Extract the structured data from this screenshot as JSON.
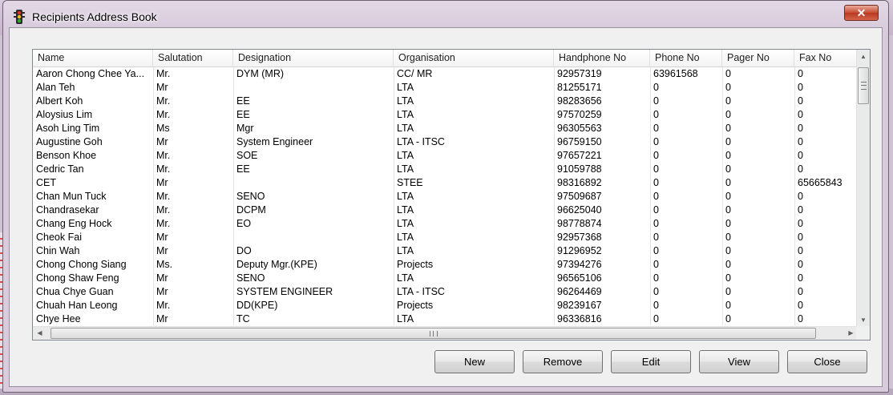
{
  "window": {
    "title": "Recipients Address Book",
    "close_symbol": "✕"
  },
  "columns": [
    "Name",
    "Salutation",
    "Designation",
    "Organisation",
    "Handphone No",
    "Phone No",
    "Pager No",
    "Fax No"
  ],
  "rows": [
    [
      "Aaron Chong Chee Ya...",
      "Mr.",
      "DYM (MR)",
      "CC/ MR",
      "92957319",
      "63961568",
      "0",
      "0"
    ],
    [
      "Alan Teh",
      "Mr",
      "",
      "LTA",
      "81255171",
      "0",
      "0",
      "0"
    ],
    [
      "Albert Koh",
      "Mr.",
      "EE",
      "LTA",
      "98283656",
      "0",
      "0",
      "0"
    ],
    [
      "Aloysius Lim",
      "Mr.",
      "EE",
      "LTA",
      "97570259",
      "0",
      "0",
      "0"
    ],
    [
      "Asoh Ling Tim",
      "Ms",
      "Mgr",
      "LTA",
      "96305563",
      "0",
      "0",
      "0"
    ],
    [
      "Augustine Goh",
      "Mr",
      "System Engineer",
      "LTA - ITSC",
      "96759150",
      "0",
      "0",
      "0"
    ],
    [
      "Benson Khoe",
      "Mr.",
      "SOE",
      "LTA",
      "97657221",
      "0",
      "0",
      "0"
    ],
    [
      "Cedric Tan",
      "Mr.",
      "EE",
      "LTA",
      "91059788",
      "0",
      "0",
      "0"
    ],
    [
      "CET",
      "Mr",
      "",
      "STEE",
      "98316892",
      "0",
      "0",
      "65665843"
    ],
    [
      "Chan Mun Tuck",
      "Mr.",
      "SENO",
      "LTA",
      "97509687",
      "0",
      "0",
      "0"
    ],
    [
      "Chandrasekar",
      "Mr.",
      "DCPM",
      "LTA",
      "96625040",
      "0",
      "0",
      "0"
    ],
    [
      "Chang Eng Hock",
      "Mr.",
      "EO",
      "LTA",
      "98778874",
      "0",
      "0",
      "0"
    ],
    [
      "Cheok Fai",
      "Mr",
      "",
      "LTA",
      "92957368",
      "0",
      "0",
      "0"
    ],
    [
      "Chin Wah",
      "Mr",
      "DO",
      "LTA",
      "91296952",
      "0",
      "0",
      "0"
    ],
    [
      "Chong Chong Siang",
      "Ms.",
      "Deputy Mgr.(KPE)",
      "Projects",
      "97394276",
      "0",
      "0",
      "0"
    ],
    [
      "Chong Shaw Feng",
      "Mr",
      "SENO",
      "LTA",
      "96565106",
      "0",
      "0",
      "0"
    ],
    [
      "Chua Chye Guan",
      "Mr",
      "SYSTEM ENGINEER",
      "LTA - ITSC",
      "96264469",
      "0",
      "0",
      "0"
    ],
    [
      "Chuah Han Leong",
      "Mr.",
      "DD(KPE)",
      "Projects",
      "98239167",
      "0",
      "0",
      "0"
    ],
    [
      "Chye Hee",
      "Mr",
      "TC",
      "LTA",
      "96336816",
      "0",
      "0",
      "0"
    ]
  ],
  "buttons": {
    "new": "New",
    "remove": "Remove",
    "edit": "Edit",
    "view": "View",
    "close": "Close"
  },
  "icons": {
    "app": "traffic-light-icon",
    "scroll_up": "▲",
    "scroll_down": "▼",
    "scroll_left": "◀",
    "scroll_right": "▶"
  }
}
